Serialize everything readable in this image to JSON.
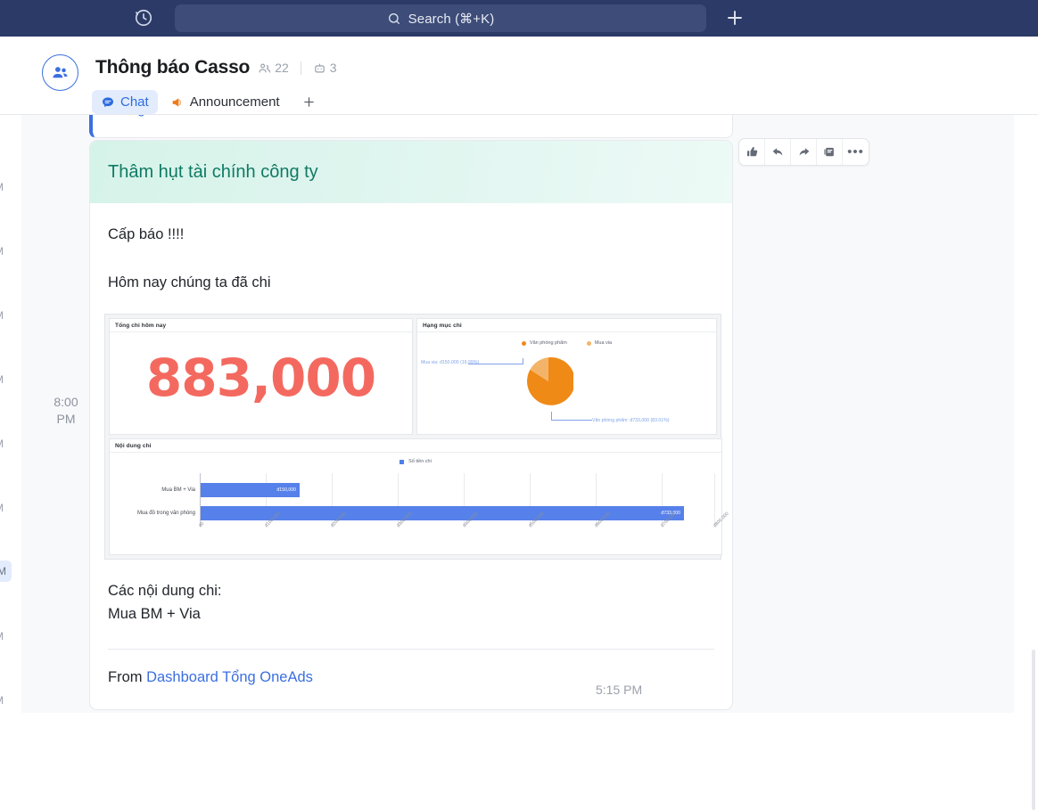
{
  "topbar": {
    "history_icon": "history-clock-icon",
    "search_placeholder": "Search (⌘+K)",
    "search_icon": "search-icon",
    "add_icon": "plus-icon",
    "background": "#2b3a67"
  },
  "channel": {
    "avatar_icon": "group-people-icon",
    "title": "Thông báo Casso",
    "members_icon": "members-icon",
    "members_count": "22",
    "bots_icon": "bot-icon",
    "bots_count": "3",
    "tabs": [
      {
        "label": "Chat",
        "icon": "chat-bubble-icon",
        "active": true
      },
      {
        "label": "Announcement",
        "icon": "megaphone-icon",
        "active": false
      }
    ],
    "add_tab_icon": "plus-icon"
  },
  "rail": {
    "clipped_stamps": [
      "M",
      "M",
      "M",
      "M",
      "M",
      "M",
      "M",
      "M",
      "M"
    ],
    "selected_index": 6
  },
  "conversation": {
    "group_time": "8:00 PM",
    "message_time": "5:15 PM"
  },
  "card": {
    "banner_title": "Thâm hụt tài chính công ty",
    "banner_color": "#0f7a63",
    "line_1": "Cấp báo !!!!",
    "line_2": "Hôm nay chúng ta đã chi",
    "line_3": "Các nội dung chi:",
    "line_4": "Mua BM + Via",
    "from_prefix": "From",
    "from_link": "Dashboard Tổng OneAds"
  },
  "actionbar": {
    "items": [
      {
        "icon": "thumbs-up-icon",
        "name": "react-like-button"
      },
      {
        "icon": "reply-arrow-icon",
        "name": "reply-button"
      },
      {
        "icon": "forward-arrow-icon",
        "name": "forward-button"
      },
      {
        "icon": "note-icon",
        "name": "save-to-note-button"
      },
      {
        "icon": "more-dots-icon",
        "name": "more-options-button"
      }
    ],
    "more_glyph": "•••"
  },
  "chart_data": [
    {
      "type": "table",
      "title": "Tổng chi hôm nay",
      "value": "883,000",
      "value_color": "#f4695f"
    },
    {
      "type": "pie",
      "title": "Hạng mục chi",
      "categories": [
        "Văn phòng phẩm",
        "Mua via"
      ],
      "values": [
        733000,
        150000
      ],
      "percents": [
        83.01,
        16.99
      ],
      "colors": [
        "#ef8a17",
        "#f3b469"
      ],
      "legend": [
        "Văn phòng phẩm",
        "Mua via"
      ],
      "legend_position": "top",
      "labels": [
        "Văn phòng phẩm: đ733,000 (83.01%)",
        "Mua via: đ150,000 (16.99%)"
      ],
      "label_color": "#7fa3e8"
    },
    {
      "type": "bar",
      "orientation": "horizontal",
      "title": "Nội dung chi",
      "categories": [
        "Mua BM + Via",
        "Mua đồ trong văn phòng"
      ],
      "values": [
        150000,
        733000
      ],
      "value_labels": [
        "đ150,000",
        "đ733,000"
      ],
      "series": [
        {
          "name": "Số tiền chi",
          "values": [
            150000,
            733000
          ]
        }
      ],
      "legend": [
        "Số tiền chi"
      ],
      "legend_position": "top",
      "bar_color": "#5680ea",
      "xlim": [
        0,
        800000
      ],
      "xticks": [
        "đ0",
        "đ100,000",
        "đ200,000",
        "đ300,000",
        "đ400,000",
        "đ500,000",
        "đ600,000",
        "đ700,000",
        "đ800,000"
      ],
      "xlabel": "",
      "ylabel": "",
      "grid": true
    }
  ]
}
